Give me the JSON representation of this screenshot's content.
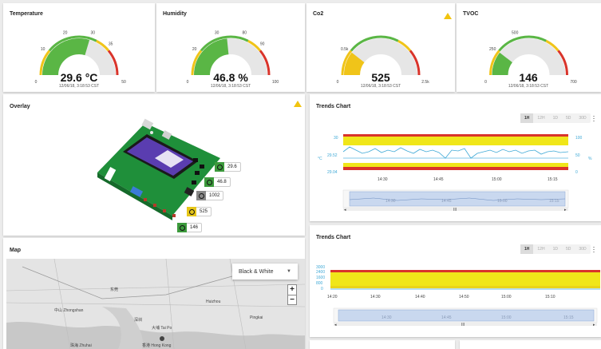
{
  "gauges": [
    {
      "title": "Temperature",
      "value": "29.6 °C",
      "time": "12/06/18, 3:18:53 CST",
      "min": "0",
      "max": "50",
      "ticks": [
        "10",
        "20",
        "30",
        "35"
      ],
      "fill_fraction": 0.592,
      "has_warning": false
    },
    {
      "title": "Humidity",
      "value": "46.8 %",
      "time": "12/06/18, 3:18:53 CST",
      "min": "0",
      "max": "100",
      "ticks": [
        "20",
        "30",
        "80",
        "90"
      ],
      "fill_fraction": 0.468,
      "has_warning": false
    },
    {
      "title": "Co2",
      "value": "525",
      "time": "12/06/18, 3:18:53 CST",
      "min": "0",
      "max": "2.5k",
      "ticks": [
        "0.5k"
      ],
      "fill_fraction": 0.21,
      "has_warning": true
    },
    {
      "title": "TVOC",
      "value": "146",
      "time": "12/06/18, 3:18:53 CST",
      "min": "0",
      "max": "700",
      "ticks": [
        "250",
        "500"
      ],
      "fill_fraction": 0.209,
      "has_warning": false
    }
  ],
  "overlay": {
    "title": "Overlay",
    "badges": [
      {
        "value": "29.6",
        "color": "#3c9a3c"
      },
      {
        "value": "46.8",
        "color": "#3c9a3c"
      },
      {
        "value": "1002",
        "color": "#888888"
      },
      {
        "value": "525",
        "color": "#e6c619"
      },
      {
        "value": "146",
        "color": "#3c9a3c"
      }
    ]
  },
  "map": {
    "title": "Map",
    "style_select": "Black & White",
    "zoom_in": "+",
    "zoom_out": "−",
    "place_labels": [
      "中山 Zhongshan",
      "东莞",
      "Huizhou",
      "大埔 Tai Po",
      "香港 Hong Kong",
      "珠海 Zhuhai",
      "深圳",
      "Pingkai"
    ]
  },
  "trends1": {
    "title": "Trends Chart",
    "ranges": [
      "1H",
      "12H",
      "1D",
      "5D",
      "30D"
    ],
    "active_range": "1H",
    "y_left": [
      "30",
      "29.52",
      "29.04"
    ],
    "y_right": [
      "100",
      "50",
      "0"
    ],
    "left_unit": "°C",
    "right_unit": "%",
    "x_ticks": [
      "14:30",
      "14:45",
      "15:00",
      "15:15"
    ],
    "nav_ticks": [
      "14:30",
      "14:45",
      "15:00",
      "15:15"
    ],
    "nav_center": "III",
    "series_color_left": "#3fa9d6",
    "series_color_right": "#5bb8e0"
  },
  "trends2": {
    "title": "Trends Chart",
    "ranges": [
      "1H",
      "12H",
      "1D",
      "5D",
      "30D"
    ],
    "active_range": "1H",
    "y_left": [
      "3000",
      "2400",
      "1600",
      "800",
      "0"
    ],
    "x_ticks": [
      "14:20",
      "14:30",
      "14:40",
      "14:50",
      "15:00",
      "15:10"
    ],
    "nav_ticks": [
      "14:30",
      "14:45",
      "15:00",
      "15:15"
    ],
    "nav_center": "III"
  },
  "colors": {
    "green": "#5ab645",
    "yellow": "#f0c419",
    "red": "#d9342b",
    "track": "#e6e6e6",
    "line_blue": "#3fa9d6"
  }
}
